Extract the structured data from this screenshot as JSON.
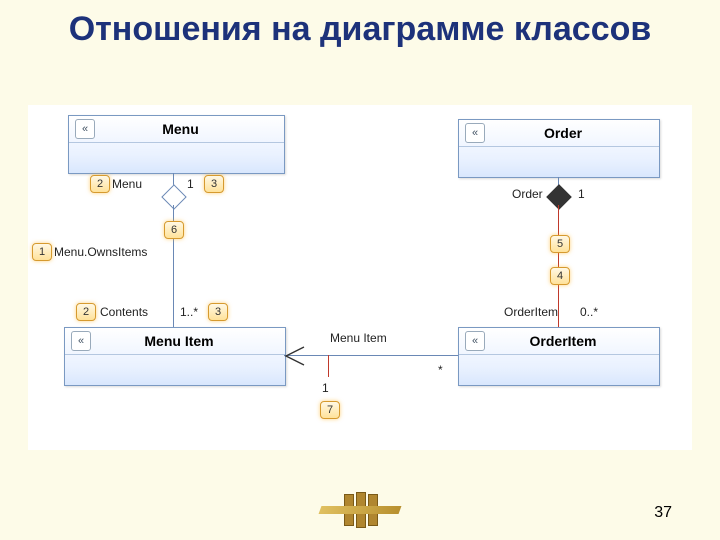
{
  "title": "Отношения на диаграмме классов",
  "pageNumber": "37",
  "classes": {
    "menu": "Menu",
    "order": "Order",
    "menuItem": "Menu Item",
    "orderItem": "OrderItem"
  },
  "labels": {
    "menuOwnsItems": "Menu.OwnsItems",
    "menu2": "Menu",
    "contents": "Contents",
    "orderLbl": "Order",
    "orderItemLbl": "OrderItem",
    "menuItemLbl": "Menu Item"
  },
  "mults": {
    "one_a": "1",
    "one_b": "1",
    "one_star": "1..*",
    "zero_star": "0..*",
    "star": "*",
    "one_c": "1"
  },
  "callouts": {
    "c1": "1",
    "c2a": "2",
    "c2b": "2",
    "c3a": "3",
    "c3b": "3",
    "c4": "4",
    "c5": "5",
    "c6": "6",
    "c7": "7"
  },
  "chev": "«"
}
